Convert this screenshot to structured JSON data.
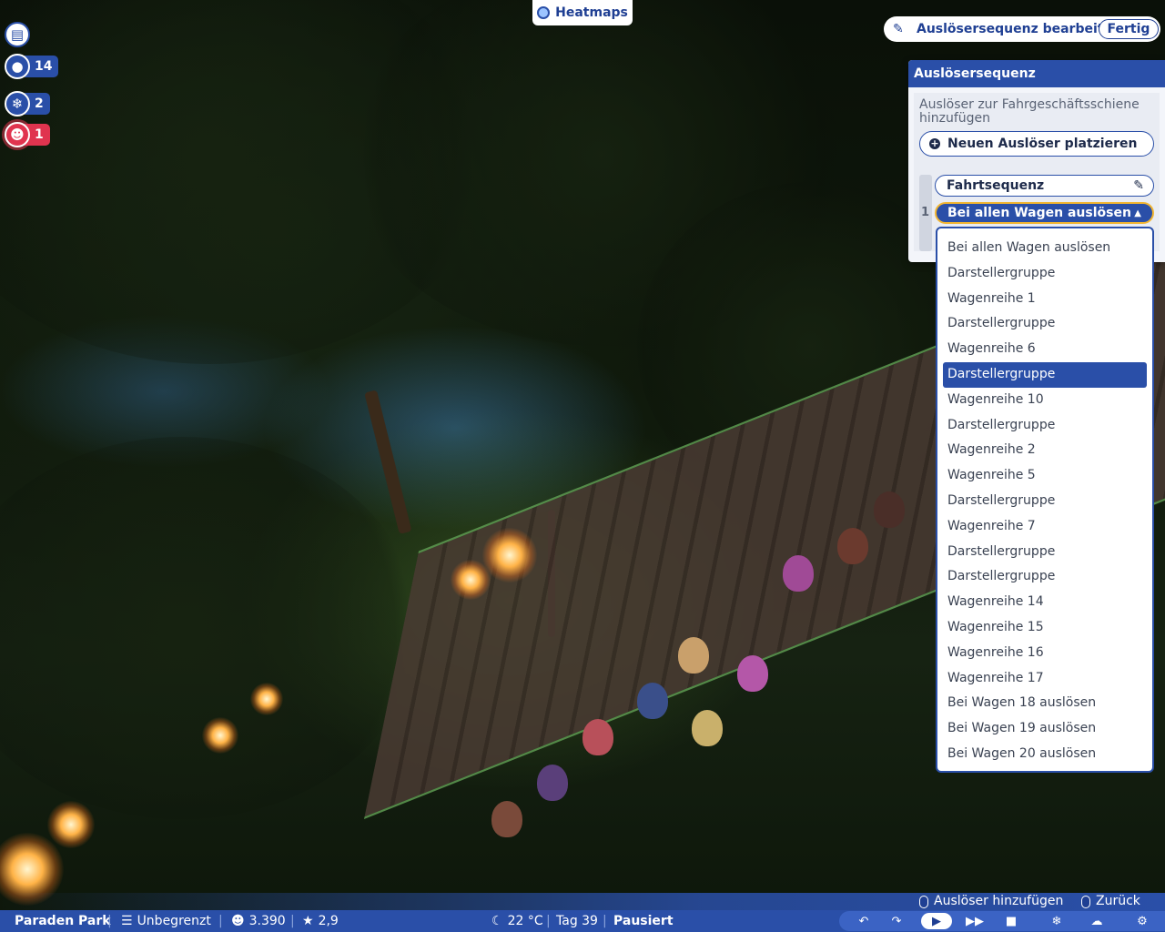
{
  "top": {
    "heatmaps_label": "Heatmaps"
  },
  "left_icons": [
    {
      "icon": "clipboard-icon",
      "count": ""
    },
    {
      "icon": "bell-icon",
      "count": "14"
    },
    {
      "icon": "ferris-wheel-icon",
      "count": "2"
    },
    {
      "icon": "guests-icon",
      "count": "1"
    }
  ],
  "edit_bar": {
    "title": "Auslösersequenz bearbeiten",
    "done_label": "Fertig"
  },
  "panel": {
    "title": "Auslösersequenz",
    "add_hint": "Auslöser zur Fahrgeschäftsschiene hinzufügen",
    "place_button": "Neuen Auslöser platzieren",
    "sequence_index": "1",
    "sequence_name": "Fahrtsequenz",
    "selected_trigger": "Bei allen Wagen auslösen"
  },
  "dropdown": {
    "options": [
      "Bei allen Wagen auslösen",
      "Darstellergruppe",
      "Wagenreihe 1",
      "Darstellergruppe",
      "Wagenreihe 6",
      "Darstellergruppe",
      "Wagenreihe 10",
      "Darstellergruppe",
      "Wagenreihe 2",
      "Wagenreihe 5",
      "Darstellergruppe",
      "Wagenreihe 7",
      "Darstellergruppe",
      "Darstellergruppe",
      "Wagenreihe 14",
      "Wagenreihe 15",
      "Wagenreihe 16",
      "Wagenreihe 17",
      "Bei Wagen 18 auslösen",
      "Bei Wagen 19 auslösen",
      "Bei Wagen 20 auslösen"
    ],
    "highlighted_index": 5
  },
  "hints": {
    "add_trigger": "Auslöser hinzufügen",
    "back": "Zurück"
  },
  "status": {
    "park_name": "Paraden Park",
    "money": "Unbegrenzt",
    "guests": "3.390",
    "rating": "2,9",
    "temperature": "22 °C",
    "day": "Tag 39",
    "state": "Pausiert"
  },
  "colors": {
    "primary": "#2a4fa8",
    "accent": "#f2b531",
    "alert": "#e0344f"
  }
}
